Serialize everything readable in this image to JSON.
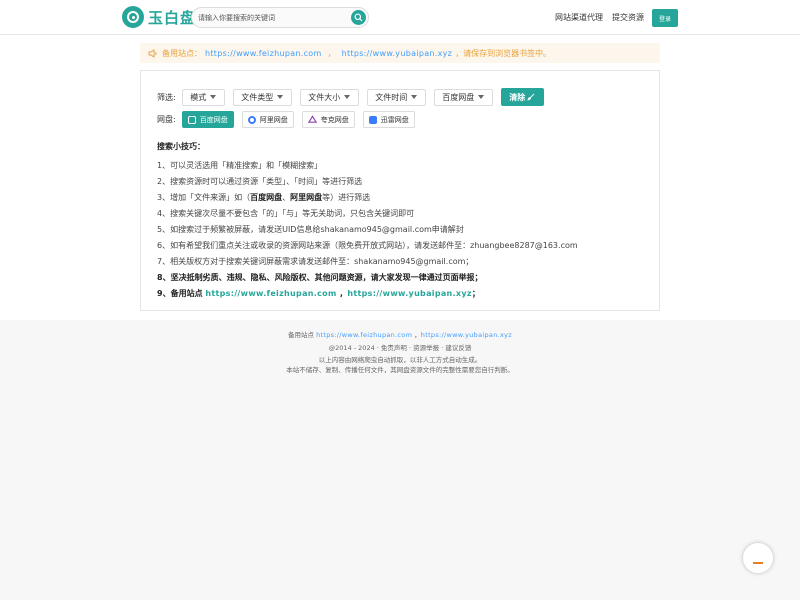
{
  "header": {
    "logo_text": "玉白盘",
    "search_placeholder": "请输入你要搜索的关键词",
    "nav": [
      "网站渠道代理",
      "提交资源"
    ],
    "login_label": "登录"
  },
  "notice": {
    "prefix": "备用站点：",
    "link1": "https://www.feizhupan.com",
    "sep": "，",
    "link2": "https://www.yubaipan.xyz",
    "suffix": "，请保存到浏览器书签中。"
  },
  "filters": {
    "label": "筛选:",
    "dropdowns": [
      "模式",
      "文件类型",
      "文件大小",
      "文件时间",
      "百度网盘"
    ],
    "clear_label": "清除"
  },
  "pans": {
    "label": "网盘:",
    "items": [
      "百度网盘",
      "阿里网盘",
      "夸克网盘",
      "迅雷网盘"
    ]
  },
  "tips": {
    "title": "搜索小技巧：",
    "t1": "1、可以灵活选用「精准搜索」和「模糊搜索」",
    "t2": "2、搜索资源时可以通过资源「类型」、「时间」等进行筛选",
    "t3_pre": "3、增加「文件来源」如（",
    "t3_b1": "百度网盘",
    "t3_mid": "、",
    "t3_b2": "阿里网盘",
    "t3_post": "等）进行筛选",
    "t4": "4、搜索关键次尽量不要包含「的」「与」等无关助词，只包含关键词即可",
    "t5": "5、如搜索过于频繁被屏蔽，请发送UID信息给shakanamo945@gmail.com申请解封",
    "t6": "6、如有希望我们重点关注或收录的资源网站来源（限免费开放式网站），请发送邮件至：zhuangbee8287@163.com",
    "t7": "7、相关版权方对于搜索关键词屏蔽需求请发送邮件至：shakanamo945@gmail.com；",
    "t8": "8、坚决抵制劣质、违规、隐私、风险版权、其他问题资源，请大家发现一律通过页面举报；",
    "t9_pre": "9、备用站点",
    "t9_link1": "https://www.feizhupan.com",
    "t9_sep": "，",
    "t9_link2": "https://www.yubaipan.xyz",
    "t9_post": "；"
  },
  "footer": {
    "line1_pre": "备用站点",
    "line1_link1": "https://www.feizhupan.com",
    "line1_sep": "，",
    "line1_link2": "https://www.yubaipan.xyz",
    "line2": "@2014 - 2024 · 免责声明 · 资源举报 · 建议反馈",
    "line3": "以上内容由网络爬虫自动抓取，以非人工方式自动生成。",
    "line4": "本站不储存、复制、传播任何文件，其网盘资源文件的完整性需要您自行判断。"
  },
  "colors": {
    "brand": "#26a69a",
    "link": "#409eff",
    "notice_text": "#e6a23c",
    "notice_bg": "#fdf6ec"
  }
}
